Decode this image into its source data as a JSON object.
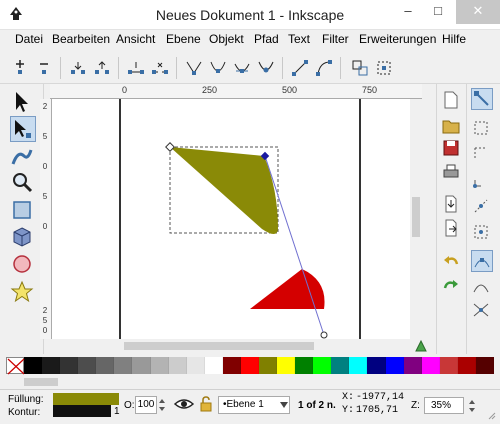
{
  "window": {
    "title": "Neues Dokument 1 - Inkscape",
    "minimize": "–",
    "maximize": "□",
    "close": "✕"
  },
  "menu": [
    "Datei",
    "Bearbeiten",
    "Ansicht",
    "Ebene",
    "Objekt",
    "Pfad",
    "Text",
    "Filter",
    "Erweiterungen",
    "Hilfe"
  ],
  "toolbar": {
    "icons": [
      "node-add-icon",
      "node-delete-icon",
      "node-join-icon",
      "node-break-icon",
      "segment-join-icon",
      "segment-delete-icon",
      "node-cusp-icon",
      "node-smooth-icon",
      "node-symmetric-icon",
      "node-auto-icon",
      "segment-line-icon",
      "segment-curve-icon",
      "object-to-path-icon",
      "stroke-to-path-icon"
    ]
  },
  "ruler": {
    "h_labels": [
      "0",
      "250",
      "500",
      "750"
    ],
    "v_labels": [
      "2",
      "5",
      "0",
      "5",
      "0",
      "2",
      "5",
      "0"
    ]
  },
  "status": {
    "fill_label": "Füllung:",
    "stroke_label": "Kontur:",
    "stroke_width": "1",
    "opacity_label": "O:",
    "opacity": "100",
    "layer": "•Ebene 1",
    "selection": "1 of 2 n.",
    "x_label": "X:",
    "x": "-1977,14",
    "y_label": "Y:",
    "y": "1705,71",
    "zoom_label": "Z:",
    "zoom": "35%"
  },
  "colors": {
    "fill": "#8a8a07",
    "red": "#d40000",
    "accent": "#3a6ea5"
  },
  "palette": [
    "#000000",
    "#1a1a1a",
    "#333333",
    "#4d4d4d",
    "#666666",
    "#808080",
    "#999999",
    "#b3b3b3",
    "#cccccc",
    "#e6e6e6",
    "#ffffff",
    "#800000",
    "#ff0000",
    "#808000",
    "#ffff00",
    "#008000",
    "#00ff00",
    "#008080",
    "#00ffff",
    "#000080",
    "#0000ff",
    "#800080",
    "#ff00ff",
    "#c83737",
    "#aa0000",
    "#550000"
  ]
}
